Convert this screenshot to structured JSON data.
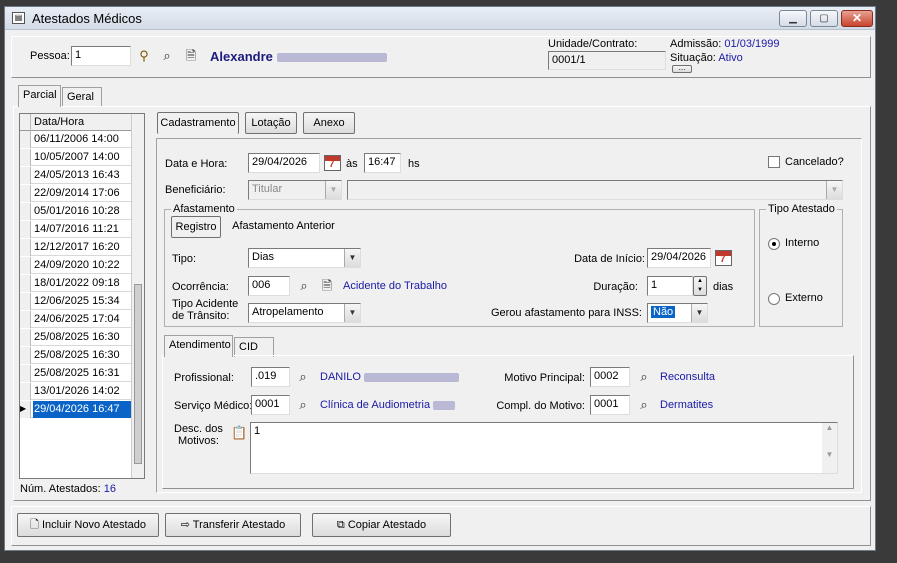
{
  "window": {
    "title": "Atestados Médicos"
  },
  "header": {
    "pessoa_label": "Pessoa:",
    "pessoa_value": "1",
    "name_first": "Alexandre",
    "unidade_label": "Unidade/Contrato:",
    "unidade_value": "0001/1",
    "admissao_label": "Admissão:",
    "admissao_value": "01/03/1999",
    "situacao_label": "Situação:",
    "situacao_value": "Ativo",
    "more_button": "..."
  },
  "outer_tabs": [
    "Parcial",
    "Geral"
  ],
  "list": {
    "header": "Data/Hora",
    "items": [
      "06/11/2006 14:00",
      "10/05/2007 14:00",
      "24/05/2013 16:43",
      "22/09/2014 17:06",
      "05/01/2016 10:28",
      "14/07/2016 11:21",
      "12/12/2017 16:20",
      "24/09/2020 10:22",
      "18/01/2022 09:18",
      "12/06/2025 15:34",
      "24/06/2025 17:04",
      "25/08/2025 16:30",
      "25/08/2025 16:30",
      "25/08/2025 16:31",
      "13/01/2026 14:02",
      "29/04/2026 16:47"
    ],
    "count_label": "Núm. Atestados:",
    "count_value": "16"
  },
  "inner_tabs": [
    "Cadastramento",
    "Lotação",
    "Anexo"
  ],
  "form": {
    "data_hora_label": "Data e Hora:",
    "data_value": "29/04/2026",
    "as_label": "às",
    "hora_value": "16:47",
    "hs_label": "hs",
    "cancelado_label": "Cancelado?",
    "beneficiario_label": "Beneficiário:",
    "beneficiario_value": "Titular",
    "afastamento_title": "Afastamento",
    "afast_tabs": [
      "Registro",
      "Afastamento Anterior"
    ],
    "tipo_label": "Tipo:",
    "tipo_value": "Dias",
    "ocorrencia_label": "Ocorrência:",
    "ocorrencia_code": "006",
    "ocorrencia_desc": "Acidente do Trabalho",
    "transito_label_1": "Tipo Acidente",
    "transito_label_2": "de Trânsito:",
    "transito_value": "Atropelamento",
    "data_inicio_label": "Data de Início:",
    "data_inicio_value": "29/04/2026",
    "duracao_label": "Duração:",
    "duracao_value": "1",
    "dias_label": "dias",
    "inss_label": "Gerou afastamento para INSS:",
    "inss_value": "Não",
    "tipo_atestado_title": "Tipo Atestado",
    "interno_label": "Interno",
    "externo_label": "Externo",
    "atend_tabs": [
      "Atendimento",
      "CID"
    ],
    "profissional_label": "Profissional:",
    "profissional_code": ".019",
    "profissional_name": "DANILO",
    "servico_label": "Serviço Médico:",
    "servico_code": "0001",
    "servico_name": "Clínica de Audiometria",
    "motivo_label": "Motivo Principal:",
    "motivo_code": "0002",
    "motivo_name": "Reconsulta",
    "compl_label": "Compl. do Motivo:",
    "compl_code": "0001",
    "compl_name": "Dermatites",
    "desc_label_1": "Desc. dos",
    "desc_label_2": "Motivos:",
    "desc_value": "1"
  },
  "footer": {
    "incluir": "Incluir Novo Atestado",
    "transferir": "Transferir Atestado",
    "copiar": "Copiar Atestado"
  }
}
